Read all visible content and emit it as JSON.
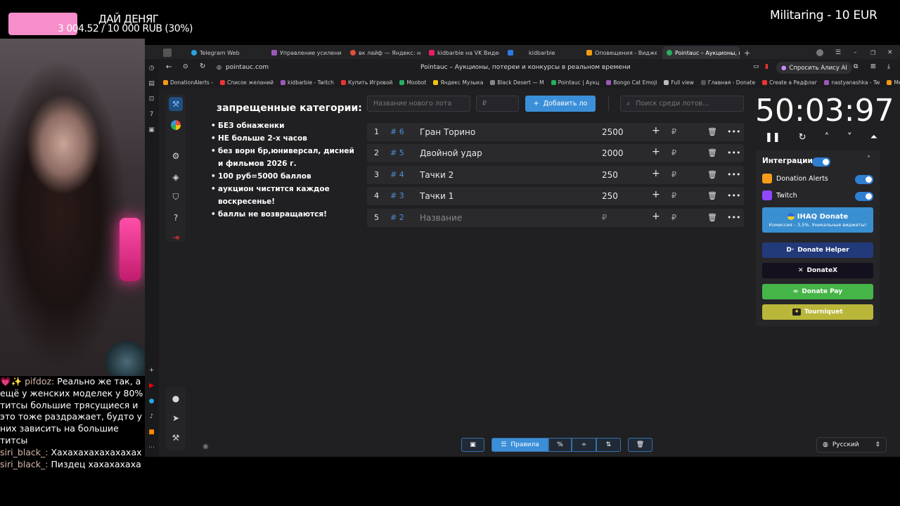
{
  "overlay": {
    "donate_title": "ДАЙ ДЕНЯГ",
    "donate_progress": "3 004.52 / 10 000 RUB (30%)",
    "donate_fraction": 0.3,
    "sub_goal": "Militaring - 10 EUR"
  },
  "chat": [
    {
      "nick": "pifdoz:",
      "text": "Реально же так, а ещё у женских моделек у 80% титсы большие трясущиеся и это тоже раздражает, будто у них зависить на большие титсы"
    },
    {
      "nick": "siri_black_:",
      "text": "Хахахахахахахахах"
    },
    {
      "nick": "siri_black_:",
      "text": "Пиздец хахахахаха"
    }
  ],
  "browser": {
    "tabs": [
      {
        "label": "Telegram Web",
        "color": "#2aa3e0"
      },
      {
        "label": "Управление усилениями",
        "color": "#9b59b6"
      },
      {
        "label": "вк лайф — Яндекс: нашё",
        "color": "#e74c3c"
      },
      {
        "label": "kidbarbie на VK Видео Li",
        "color": "#e91e63"
      },
      {
        "label": "kidbarbie",
        "color": "#2a7be4"
      },
      {
        "label": "Оповещения - Виджеты",
        "color": "#f39c12"
      },
      {
        "label": "Pointauc – Аукционы, п",
        "color": "#27ae60"
      }
    ],
    "url": "pointauc.com",
    "page_title": "Pointauc – Аукционы, потереи и конкурсы в реальном времени",
    "alice_label": "Спросить Алису AI",
    "bookmarks": [
      "DonationAlerts -",
      "Список желаний",
      "kidbarbie - Twitch",
      "Купить Игровой",
      "Moobot",
      "Яндекс Музыка",
      "Black Desert — M",
      "Pointauc | Аукц",
      "Bongo Cat Emoji",
      "Full view",
      "Главная - Donate",
      "Create a Редфлаг",
      "nastyanashka - Tw",
      "Meong Pack Em"
    ]
  },
  "rules": {
    "title": "запрещенные категории:",
    "items": [
      "БЕЗ обнаженки",
      "НЕ больше 2-х часов",
      "без ворн бр,юниверсал, дисней и фильмов 2026 г.",
      "100 руб=5000 баллов",
      "аукцион чистится каждое воскресенье!",
      "баллы не возвращаются!"
    ]
  },
  "toolbar": {
    "lot_name_placeholder": "Название нового лота",
    "amount_placeholder": "₽",
    "add_label": "Добавить ло",
    "search_placeholder": "Поиск среди лотов..."
  },
  "lots": [
    {
      "n": "1",
      "id": "# 6",
      "name": "Гран Торино",
      "amount": "2500",
      "cur": "₽"
    },
    {
      "n": "2",
      "id": "# 5",
      "name": "Двойной удар",
      "amount": "2000",
      "cur": "₽"
    },
    {
      "n": "3",
      "id": "# 4",
      "name": "Тачки 2",
      "amount": "250",
      "cur": "₽"
    },
    {
      "n": "4",
      "id": "# 3",
      "name": "Тачки 1",
      "amount": "250",
      "cur": "₽"
    },
    {
      "n": "5",
      "id": "# 2",
      "name": "Название",
      "amount": "₽",
      "cur": "₽"
    }
  ],
  "timer": {
    "value": "50:03:97"
  },
  "integrations": {
    "title": "Интеграции",
    "donation_alerts": "Donation Alerts",
    "twitch": "Twitch",
    "ihaq_title": "IHAQ Donate",
    "ihaq_sub": "Комиссия – 3,5%. Уникальные виджеты!",
    "donate_helper": "Donate Helper",
    "donatex": "DonateX",
    "donate_pay": "Donate Pay",
    "tourniquet": "Tourniquet"
  },
  "bottom_tools": {
    "rules_label": "Правила",
    "percent": "%"
  },
  "language": "Русский"
}
